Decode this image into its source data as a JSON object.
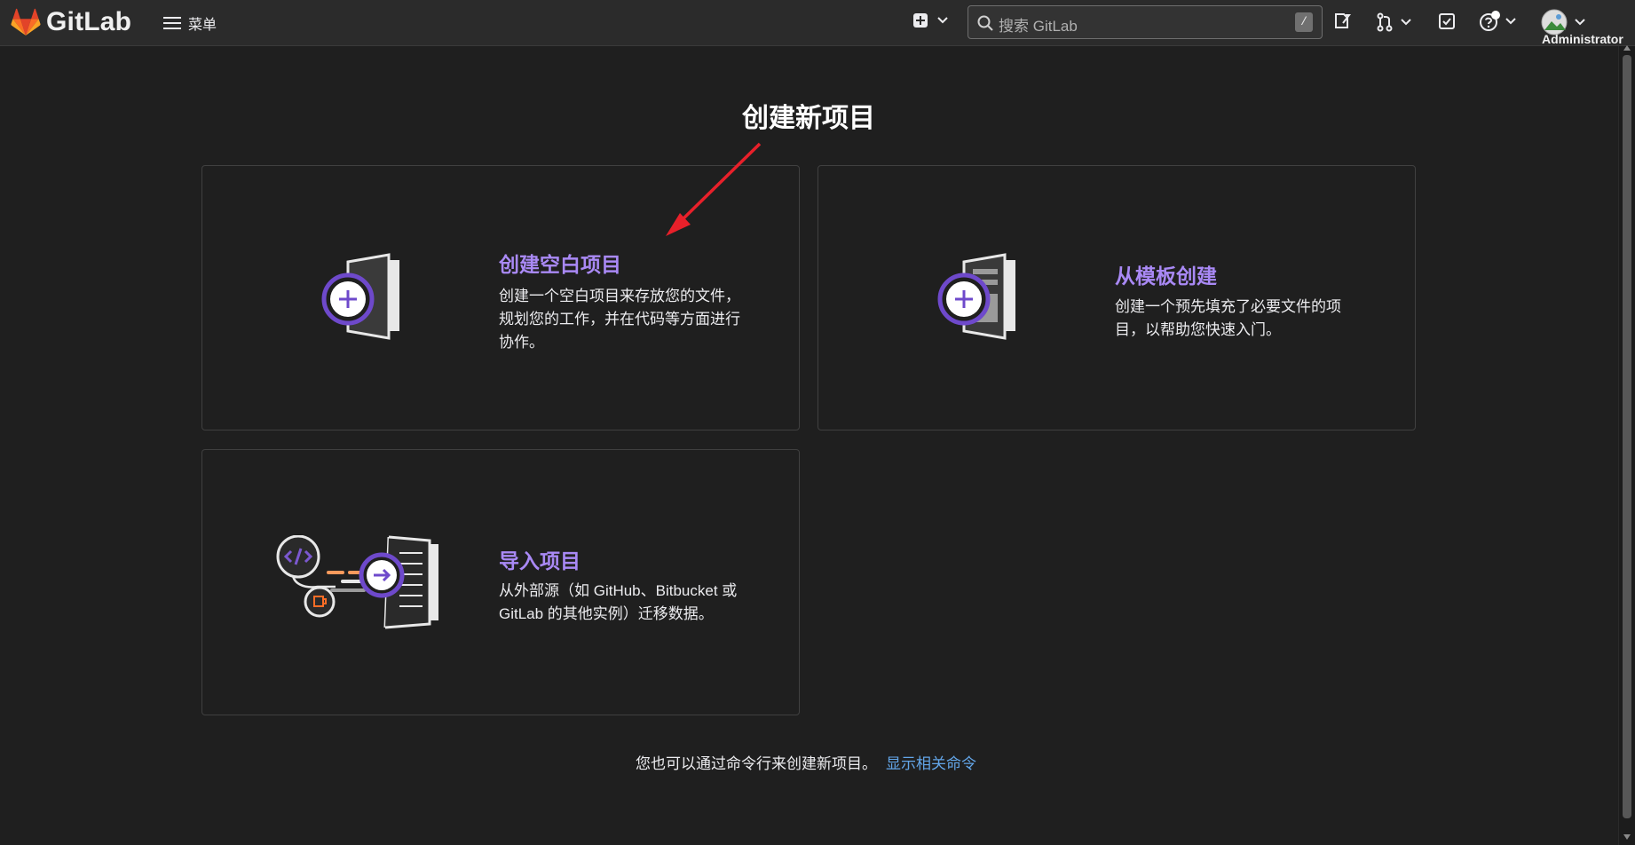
{
  "navbar": {
    "brand": "GitLab",
    "menu_label": "菜单",
    "search_placeholder": "搜索 GitLab",
    "search_shortcut": "/",
    "user_name": "Administrator"
  },
  "page": {
    "title": "创建新项目"
  },
  "cards": [
    {
      "title": "创建空白项目",
      "desc_lines": [
        "创建一个空白项目来存放您的文件，",
        "规划您的工作，并在代码等方面进行",
        "协作。"
      ]
    },
    {
      "title": "从模板创建",
      "desc_lines": [
        "创建一个预先填充了必要文件的项",
        "目，以帮助您快速入门。"
      ]
    },
    {
      "title": "导入项目",
      "desc_lines": [
        "从外部源（如 GitHub、Bitbucket 或",
        "GitLab 的其他实例）迁移数据。"
      ]
    }
  ],
  "footer": {
    "text": "您也可以通过命令行来创建新项目。",
    "link": "显示相关命令"
  },
  "colors": {
    "accent_purple": "#a989f5",
    "link_blue": "#63a6e9",
    "annotation_red": "#e8202a",
    "gitlab_orange": "#fc6d26"
  }
}
